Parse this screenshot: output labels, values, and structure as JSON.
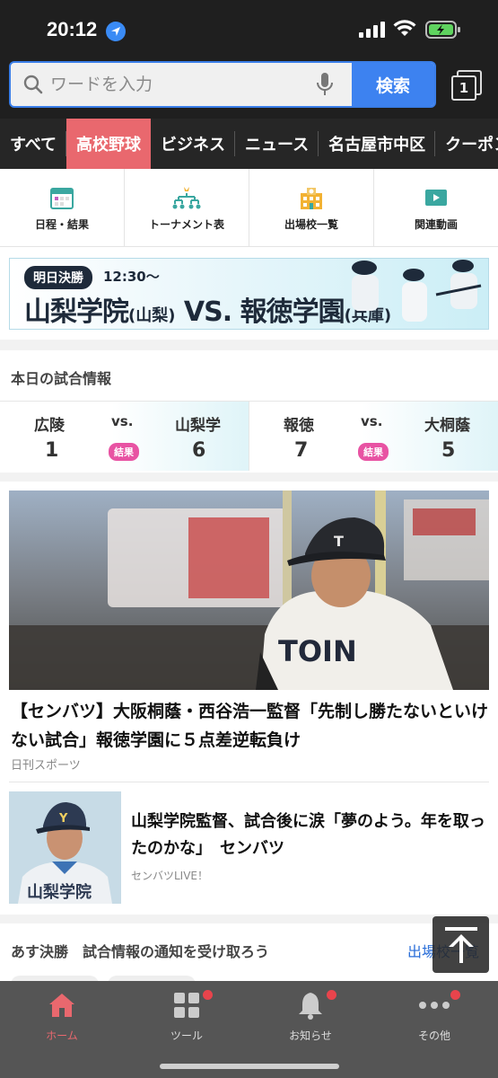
{
  "status": {
    "time": "20:12"
  },
  "search": {
    "placeholder": "ワードを入力",
    "button": "検索",
    "tab_count": "1"
  },
  "categories": [
    {
      "label": "すべて"
    },
    {
      "label": "高校野球",
      "active": true
    },
    {
      "label": "ビジネス"
    },
    {
      "label": "ニュース"
    },
    {
      "label": "名古屋市中区"
    },
    {
      "label": "クーポン"
    }
  ],
  "quicknav": [
    {
      "label": "日程・結果",
      "icon": "calendar-icon"
    },
    {
      "label": "トーナメント表",
      "icon": "tournament-icon"
    },
    {
      "label": "出場校一覧",
      "icon": "school-icon"
    },
    {
      "label": "関連動画",
      "icon": "video-icon"
    }
  ],
  "banner": {
    "pill": "明日決勝",
    "time": "12:30〜",
    "team1": "山梨学院",
    "team1_pref": "(山梨)",
    "vs": "VS.",
    "team2": "報徳学園",
    "team2_pref": "(兵庫)"
  },
  "today": {
    "title": "本日の試合情報",
    "games": [
      {
        "team1": "広陵",
        "score1": "1",
        "vs": "vs.",
        "badge": "結果",
        "team2": "山梨学",
        "score2": "6"
      },
      {
        "team1": "報徳",
        "score1": "7",
        "vs": "vs.",
        "badge": "結果",
        "team2": "大桐蔭",
        "score2": "5"
      }
    ]
  },
  "article": {
    "title": "【センバツ】大阪桐蔭・西谷浩一監督「先制し勝たないといけない試合」報徳学園に５点差逆転負け",
    "source": "日刊スポーツ",
    "hero_jersey": "TOIN",
    "sub_title": "山梨学院監督、試合後に涙「夢のよう。年を取ったのかな」　センバツ",
    "sub_source": "センバツLIVE！",
    "sub_jersey": "山梨学院"
  },
  "tomorrow": {
    "title": "あす決勝　試合情報の通知を受け取ろう",
    "link": "出場校一覧"
  },
  "tabbar": [
    {
      "label": "ホーム",
      "icon": "home-icon",
      "active": true
    },
    {
      "label": "ツール",
      "icon": "tools-icon"
    },
    {
      "label": "お知らせ",
      "icon": "bell-icon"
    },
    {
      "label": "その他",
      "icon": "more-icon"
    }
  ],
  "colors": {
    "accent": "#e9686e",
    "search_blue": "#3d82f0",
    "badge_pink": "#e853a3",
    "dark": "#1f1f1f"
  }
}
